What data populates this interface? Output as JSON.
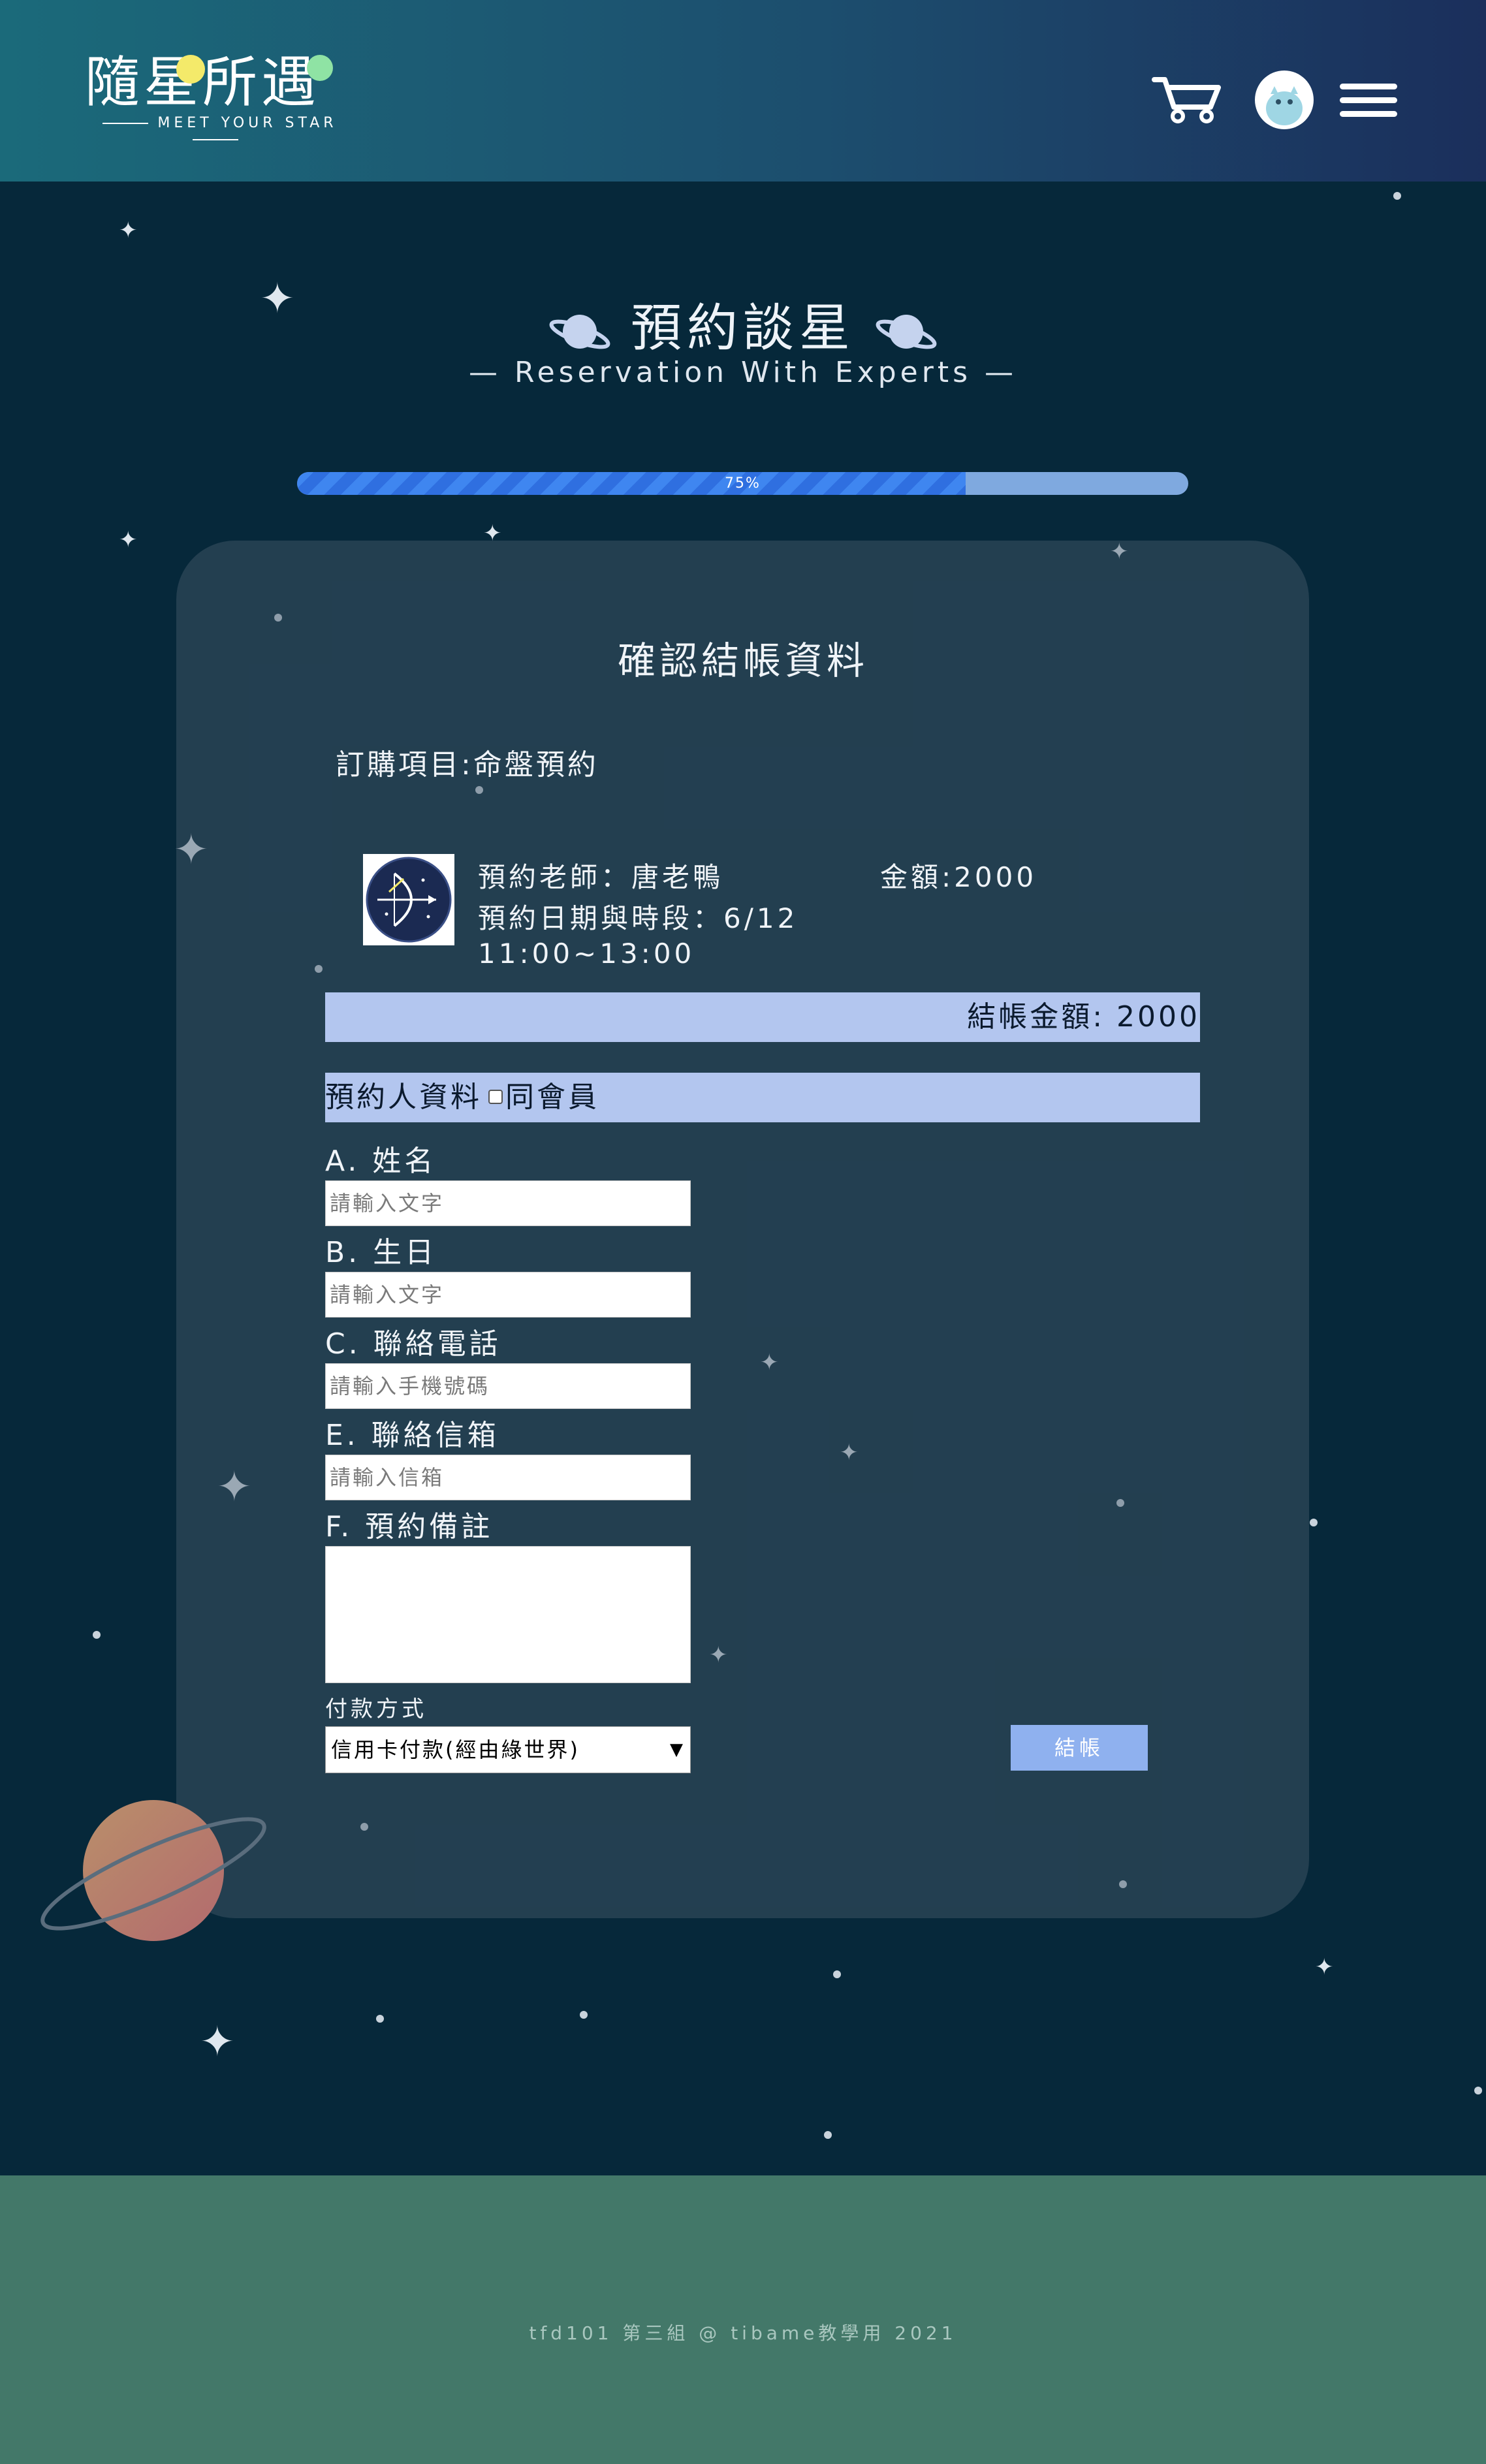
{
  "header": {
    "logo_title": "隨星所遇",
    "logo_subtitle": "MEET YOUR STAR"
  },
  "page": {
    "title": "預約談星",
    "subtitle": "— Reservation With Experts —"
  },
  "progress": {
    "label": "75%",
    "value": 0.75
  },
  "checkout": {
    "heading": "確認結帳資料",
    "order_item": "訂購項目:命盤預約",
    "teacher": "預約老師：唐老鴨",
    "date_line1": "預約日期與時段：6/12",
    "date_line2": "11:00~13:00",
    "price": "金額:2000",
    "total": "結帳金額: 2000"
  },
  "member": {
    "label": "預約人資料",
    "same_member": "同會員"
  },
  "form": {
    "name_label": "A. 姓名",
    "name_placeholder": "請輸入文字",
    "birthday_label": "B. 生日",
    "birthday_placeholder": "請輸入文字",
    "phone_label": "C. 聯絡電話",
    "phone_placeholder": "請輸入手機號碼",
    "email_label": "E. 聯絡信箱",
    "email_placeholder": "請輸入信箱",
    "note_label": "F. 預約備註"
  },
  "payment": {
    "label": "付款方式",
    "selected": "信用卡付款(經由綠世界)",
    "submit": "結帳"
  },
  "footer": {
    "text": "tfd101 第三組 @ tibame教學用 2021"
  },
  "colors": {
    "background": "#06283a",
    "accent_bar": "#b3c6ef",
    "progress_fill": "#3f86f0",
    "button": "#8fb1ef",
    "footer": "#437869"
  }
}
